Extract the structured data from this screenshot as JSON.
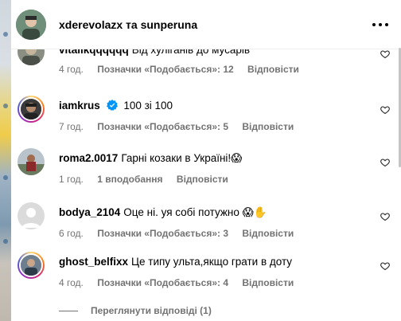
{
  "post_header": {
    "title": "xderevolazx та sunperuna"
  },
  "comments": [
    {
      "username": "vitalikqqqqqq",
      "text": "Від хуліганів до мусарів",
      "time": "4 год.",
      "likes": "Позначки «Подобається»: 12",
      "reply": "Відповісти"
    },
    {
      "username": "iamkrus",
      "text": "100 зі 100",
      "time": "7 год.",
      "likes": "Позначки «Подобається»: 5",
      "reply": "Відповісти",
      "verified": true
    },
    {
      "username": "roma2.0017",
      "text": "Гарні козаки в Україні!😱",
      "time": "1 год.",
      "likes": "1 вподобання",
      "reply": "Відповісти"
    },
    {
      "username": "bodya_2104",
      "text": "Оце ні. уя собі потужно 😱✋",
      "time": "6 год.",
      "likes": "Позначки «Подобається»: 3",
      "reply": "Відповісти"
    },
    {
      "username": "ghost_belfixx",
      "text": "Це типу ульта,якщо грати в доту",
      "time": "4 год.",
      "likes": "Позначки «Подобається»: 4",
      "reply": "Відповісти"
    }
  ],
  "view_replies": "Переглянути відповіді (1)",
  "colors": {
    "secondary_text": "#737373",
    "verified_blue": "#0095f6"
  },
  "icons": [
    "more-options-icon",
    "heart-icon",
    "verified-badge-icon"
  ]
}
